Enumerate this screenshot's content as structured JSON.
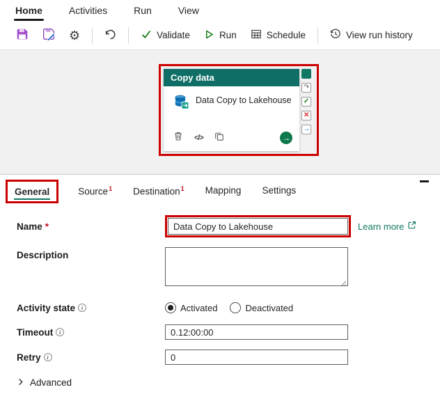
{
  "menu": {
    "items": [
      {
        "label": "Home"
      },
      {
        "label": "Activities"
      },
      {
        "label": "Run"
      },
      {
        "label": "View"
      }
    ]
  },
  "toolbar": {
    "validate": "Validate",
    "run": "Run",
    "schedule": "Schedule",
    "view_run_history": "View run history"
  },
  "canvas": {
    "card": {
      "header": "Copy data",
      "title": "Data Copy to Lakehouse"
    }
  },
  "pane": {
    "tabs": [
      {
        "label": "General",
        "badge": ""
      },
      {
        "label": "Source",
        "badge": "1"
      },
      {
        "label": "Destination",
        "badge": "1"
      },
      {
        "label": "Mapping",
        "badge": ""
      },
      {
        "label": "Settings",
        "badge": ""
      }
    ],
    "name": {
      "label": "Name",
      "required": "*",
      "value": "Data Copy to Lakehouse",
      "learn_more": "Learn more"
    },
    "description": {
      "label": "Description",
      "value": ""
    },
    "activity_state": {
      "label": "Activity state",
      "options": [
        {
          "label": "Activated"
        },
        {
          "label": "Deactivated"
        }
      ],
      "selected": "Activated"
    },
    "timeout": {
      "label": "Timeout",
      "value": "0.12:00:00"
    },
    "retry": {
      "label": "Retry",
      "value": "0"
    },
    "advanced": {
      "label": "Advanced"
    }
  },
  "icons": {
    "code": "</>",
    "arrow_right": "→",
    "check": "✓",
    "cross": "✕",
    "redo": "↷",
    "chevron": "›",
    "gear": "⚙"
  },
  "colors": {
    "teal": "#117865",
    "annotation_red": "#cc0000",
    "green": "#107c10",
    "purple": "#9a4bbe",
    "blue": "#0078d4",
    "red": "#d13438"
  }
}
